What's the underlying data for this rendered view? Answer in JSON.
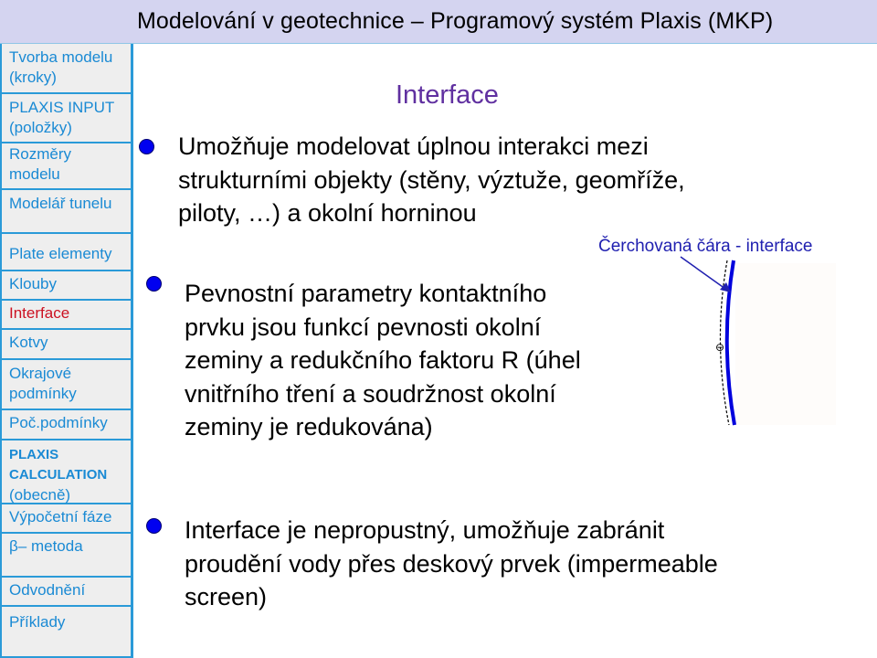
{
  "header": {
    "title": "Modelování v geotechnice – Programový systém Plaxis (MKP)"
  },
  "sidebar": {
    "items": [
      {
        "label": "Tvorba modelu (kroky)",
        "lines": [
          "Tvorba modelu",
          "(kroky)"
        ],
        "active": false
      },
      {
        "label": "PLAXIS INPUT (položky)",
        "lines": [
          "PLAXIS INPUT",
          "(položky)"
        ],
        "active": false
      },
      {
        "label": "Rozměry modelu",
        "lines": [
          "Rozměry",
          "modelu"
        ],
        "active": false
      },
      {
        "label": "Modelář tunelu",
        "lines": [
          "Modelář tunelu"
        ],
        "active": false
      },
      {
        "label": "Plate elementy",
        "lines": [
          "Plate elementy"
        ],
        "active": false
      },
      {
        "label": "Klouby",
        "lines": [
          "Klouby"
        ],
        "active": false
      },
      {
        "label": "Interface",
        "lines": [
          "Interface"
        ],
        "active": true
      },
      {
        "label": "Kotvy",
        "lines": [
          "Kotvy"
        ],
        "active": false
      },
      {
        "label": "Okrajové podmínky",
        "lines": [
          "Okrajové",
          "podmínky"
        ],
        "active": false
      },
      {
        "label": "Poč.podmínky",
        "lines": [
          "Poč.podmínky"
        ],
        "active": false
      },
      {
        "label": "PLAXIS CALCULATION (obecně)",
        "lines": [
          "PLAXIS",
          "CALCULATION",
          "(obecně)"
        ],
        "active": false
      },
      {
        "label": "Výpočetní fáze",
        "lines": [
          "Výpočetní fáze"
        ],
        "active": false
      },
      {
        "label": "β– metoda",
        "lines": [
          "β– metoda"
        ],
        "active": false
      },
      {
        "label": "Odvodnění",
        "lines": [
          "Odvodnění"
        ],
        "active": false
      },
      {
        "label": "Příklady",
        "lines": [
          "Příklady"
        ],
        "active": false
      }
    ],
    "colors": {
      "link": "#1a8ad4",
      "active": "#cc1122",
      "border": "#2a9ad8"
    }
  },
  "main": {
    "title": "Interface",
    "bullets": [
      {
        "lines": [
          "Umožňuje modelovat úplnou interakci mezi",
          "strukturními objekty (stěny, výztuže, geomříže,",
          "piloty, …) a okolní horninou"
        ]
      },
      {
        "lines": [
          "Pevnostní parametry kontaktního",
          "prvku jsou funkcí pevnosti okolní",
          "zeminy a redukčního faktoru R (úhel",
          "vnitřního tření a soudržnost okolní",
          "zeminy je redukována)"
        ]
      },
      {
        "lines": [
          "Interface je nepropustný, umožňuje zabránit",
          "proudění vody přes deskový prvek (impermeable",
          "screen)"
        ]
      }
    ],
    "figure": {
      "caption": "Čerchovaná čára -  interface",
      "symbol": "⊖",
      "colors": {
        "plate": "#0000dd",
        "interface": "#000000",
        "caption": "#2020b0",
        "soil": "#fefcfa"
      }
    }
  }
}
